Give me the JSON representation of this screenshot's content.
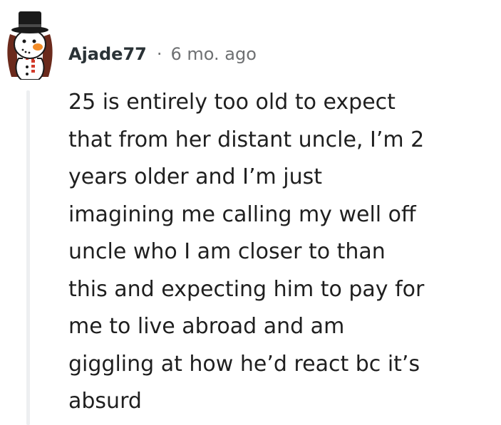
{
  "comment": {
    "author": {
      "username": "Ajade77",
      "avatar_icon": "snowman-avatar-icon"
    },
    "separator": "·",
    "timestamp": "6 mo. ago",
    "body_lines": [
      "25 is entirely too old to expect",
      "that from her distant uncle, I’m 2",
      "years older and I’m just",
      "imagining me calling my well off",
      "uncle who I am closer to than",
      "this and expecting him to pay for",
      "me to live abroad and am",
      "giggling at how he’d react bc it’s",
      "absurd"
    ]
  },
  "colors": {
    "text": "#1f1f1f",
    "username": "#2a3236",
    "meta": "#6e7072",
    "thread_line": "#edeff1",
    "avatar_hair": "#6b2a1c"
  }
}
